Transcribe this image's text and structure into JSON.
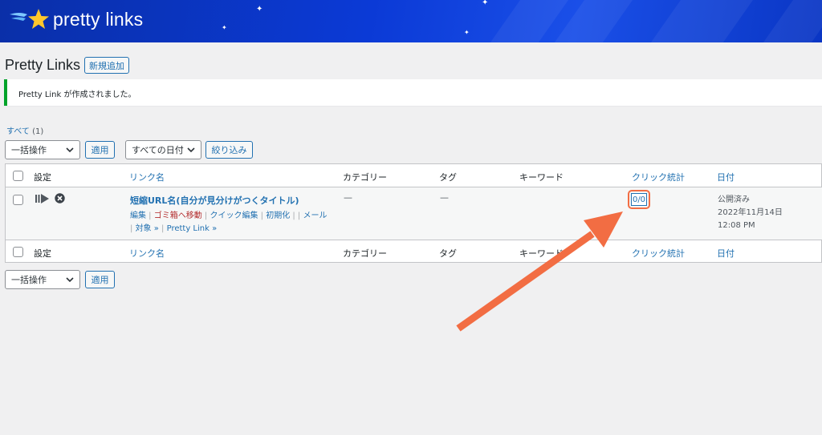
{
  "header": {
    "logo_text": "pretty links"
  },
  "page": {
    "title": "Pretty Links",
    "add_new_label": "新規追加"
  },
  "notice": {
    "text": "Pretty Link が作成されました。"
  },
  "filters": {
    "all_label": "すべて",
    "all_count": "(1)",
    "bulk_action": "一括操作",
    "apply": "適用",
    "date_filter": "すべての日付",
    "filter_button": "絞り込み"
  },
  "table": {
    "columns": {
      "settings": "設定",
      "link_name": "リンク名",
      "category": "カテゴリー",
      "tags": "タグ",
      "keywords": "キーワード",
      "click_stats": "クリック統計",
      "date": "日付"
    },
    "rows": [
      {
        "title": "短縮URL名(自分が見分けがつくタイトル)",
        "category": "—",
        "tags": "—",
        "actions": {
          "edit": "編集",
          "trash": "ゴミ箱へ移動",
          "quick_edit": "クイック編集",
          "reset": "初期化",
          "mail": "メール",
          "target": "対象 »",
          "pretty_link": "Pretty Link »"
        },
        "clicks": "0/0",
        "status": "公開済み",
        "date": "2022年11月14日",
        "time": "12:08 PM"
      }
    ]
  },
  "bottom": {
    "bulk_action": "一括操作",
    "apply": "適用"
  },
  "colors": {
    "accent": "#2271b1",
    "annotation": "#f26d43",
    "success": "#00a32a",
    "banner": "#0b3ad6"
  }
}
